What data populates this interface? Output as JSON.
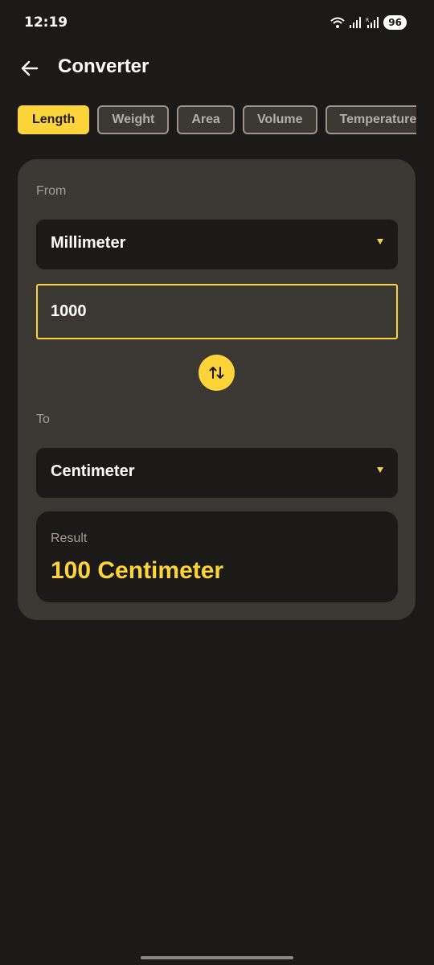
{
  "status_bar": {
    "time": "12:19",
    "battery": "96",
    "icons": [
      "wifi-icon",
      "signal-icon",
      "signal-r-icon"
    ]
  },
  "app_bar": {
    "title": "Converter",
    "back_icon": "arrow-left-icon"
  },
  "categories": [
    {
      "label": "Length",
      "active": true
    },
    {
      "label": "Weight",
      "active": false
    },
    {
      "label": "Area",
      "active": false
    },
    {
      "label": "Volume",
      "active": false
    },
    {
      "label": "Temperature",
      "active": false
    }
  ],
  "converter": {
    "from_label": "From",
    "from_unit": "Millimeter",
    "amount": "1000",
    "swap_icon": "swap-vertical-icon",
    "to_label": "To",
    "to_unit": "Centimeter",
    "result_label": "Result",
    "result_value": "100 Centimeter"
  },
  "colors": {
    "background": "#1c1a19",
    "card": "#3b3834",
    "accent": "#fdd33a",
    "muted_text": "#a39d93"
  }
}
